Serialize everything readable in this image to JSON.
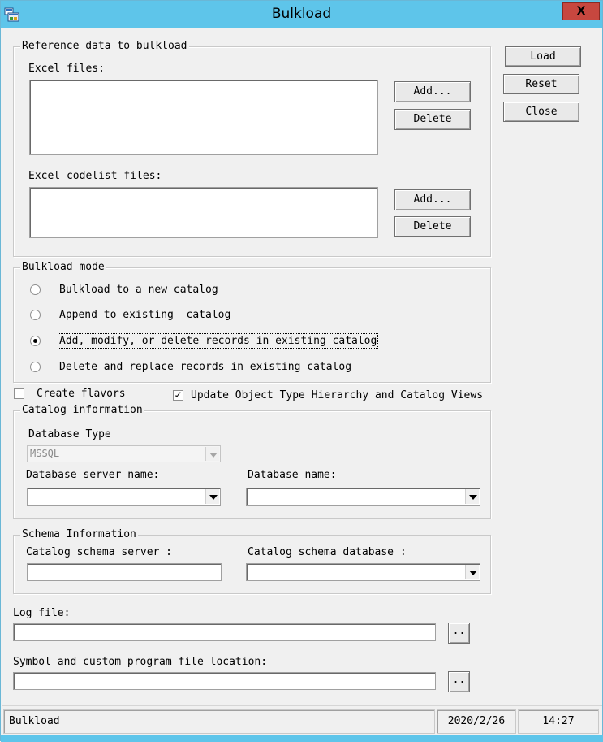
{
  "window": {
    "title": "Bulkload",
    "close_glyph": "X",
    "app_icon": "bulkload-app-icon"
  },
  "side_buttons": {
    "load": "Load",
    "reset": "Reset",
    "close": "Close"
  },
  "reference": {
    "legend": "Reference data to bulkload",
    "excel_files_label": "Excel files:",
    "excel_add": "Add...",
    "excel_delete": "Delete",
    "codelist_label": "Excel codelist files:",
    "codelist_add": "Add...",
    "codelist_delete": "Delete"
  },
  "mode": {
    "legend": "Bulkload mode",
    "options": [
      {
        "label": "Bulkload to a new catalog",
        "selected": false
      },
      {
        "label": "Append to existing  catalog",
        "selected": false
      },
      {
        "label": "Add, modify, or delete records in existing catalog",
        "selected": true
      },
      {
        "label": "Delete and replace records in existing catalog",
        "selected": false
      }
    ]
  },
  "options": {
    "create_flavors": "Create flavors",
    "create_flavors_checked": false,
    "update_hierarchy": "Update Object Type Hierarchy and Catalog Views",
    "update_hierarchy_checked": true,
    "check_glyph": "✓"
  },
  "catalog": {
    "legend": "Catalog information",
    "db_type_label": "Database Type",
    "db_type_value": "MSSQL",
    "server_label": "Database server name:",
    "server_value": "",
    "dbname_label": "Database name:",
    "dbname_value": ""
  },
  "schema": {
    "legend": "Schema Information",
    "server_label": "Catalog schema server :",
    "server_value": "",
    "database_label": "Catalog schema database :",
    "database_value": ""
  },
  "log": {
    "label": "Log file:",
    "value": "",
    "browse": ".."
  },
  "symbol": {
    "label": "Symbol and custom program file location:",
    "value": "",
    "browse": ".."
  },
  "status": {
    "text": "Bulkload",
    "date": "2020/2/26",
    "time": "14:27"
  }
}
